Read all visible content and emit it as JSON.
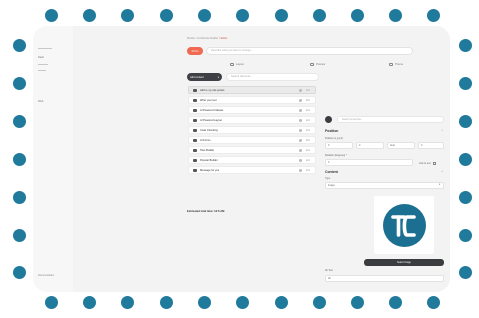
{
  "frame": {
    "dot_color": "#1f7a9c",
    "accent": "#ef6a50",
    "dark": "#3a3c40",
    "logo_color": "#1b7092"
  },
  "topbar": {
    "strong": "Get started with AI Website Builder",
    "rest": " — add AI elements, choose a template and customize your design. ",
    "link": "Learn more"
  },
  "sidebar": {
    "item_1": "Dash",
    "item_2": "Web",
    "footer": "Documentation"
  },
  "breadcrumb": {
    "part_1": "Builder",
    "sep_1": " / ",
    "part_2": "AI Website Builder",
    "sep_2": " / ",
    "current": "Editor"
  },
  "ai_button": "AI Pro",
  "prompt_placeholder": "Describe what you want to change...",
  "tabs": [
    "Layout",
    "Preview",
    "Theme"
  ],
  "add_button": "Add content",
  "search_placeholder": "Search elements...",
  "elements": [
    {
      "icon": "image-icon",
      "label": "Add to my site preset",
      "action": "Edit",
      "selected": true
    },
    {
      "icon": "text-icon",
      "label": "Write your text",
      "action": "Edit",
      "selected": false
    },
    {
      "icon": "ai-icon",
      "label": "AI Powered Classes",
      "action": "Edit",
      "selected": false
    },
    {
      "icon": "ai-icon",
      "label": "AI Powered Layout",
      "action": "Edit",
      "selected": false
    },
    {
      "icon": "code-icon",
      "label": "Code Checking",
      "action": "Edit",
      "selected": false
    },
    {
      "icon": "ai-icon",
      "label": "AI Forms",
      "action": "Edit",
      "selected": false
    },
    {
      "icon": "image-icon",
      "label": "Tiles Builder",
      "action": "Edit",
      "selected": false
    },
    {
      "icon": "image-icon",
      "label": "Popular Builder",
      "action": "Edit",
      "selected": false
    },
    {
      "icon": "message-icon",
      "label": "Message for you",
      "action": "Edit",
      "selected": false
    }
  ],
  "estimated": "Estimated total time: 12:6 AM",
  "right_panel": {
    "search_placeholder": "Search properties...",
    "position_title": "Position",
    "position_label": "Position (x,y,w,h)",
    "pos_values": [
      "0",
      "0",
      "Auto",
      "0"
    ],
    "rotation_label": "Rotation (Degrees) *",
    "rotation_value": "0",
    "link_label": "Link to text",
    "content_title": "Content",
    "type_label": "Type",
    "type_value": "Image",
    "select_button": "Select Image",
    "alt_label": "Alt Text",
    "alt_value": "Alt"
  }
}
